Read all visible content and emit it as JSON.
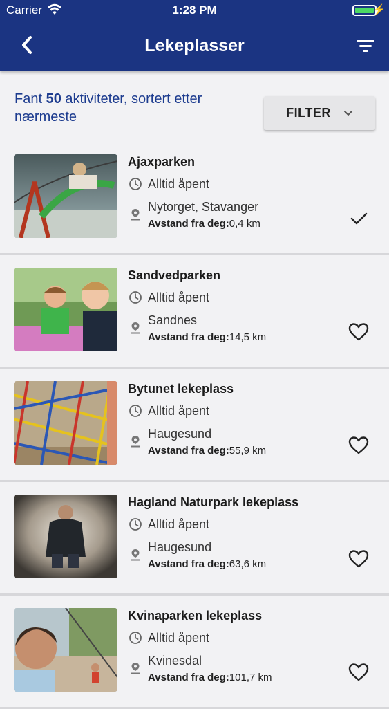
{
  "status": {
    "carrier": "Carrier",
    "time": "1:28 PM"
  },
  "header": {
    "title": "Lekeplasser"
  },
  "summary": {
    "prefix": "Fant ",
    "count": "50",
    "suffix": " aktiviteter, sortert etter nærmeste"
  },
  "filter": {
    "label": "FILTER"
  },
  "distance_label": "Avstand fra deg:",
  "items": [
    {
      "name": "Ajaxparken",
      "hours": "Alltid åpent",
      "place": "Nytorget, Stavanger",
      "distance": "0,4 km",
      "state": "visited"
    },
    {
      "name": "Sandvedparken",
      "hours": "Alltid åpent",
      "place": "Sandnes",
      "distance": "14,5 km",
      "state": "favorite"
    },
    {
      "name": "Bytunet lekeplass",
      "hours": "Alltid åpent",
      "place": "Haugesund",
      "distance": "55,9 km",
      "state": "favorite"
    },
    {
      "name": "Hagland Naturpark lekeplass",
      "hours": "Alltid åpent",
      "place": "Haugesund",
      "distance": "63,6 km",
      "state": "favorite"
    },
    {
      "name": "Kvinaparken lekeplass",
      "hours": "Alltid åpent",
      "place": "Kvinesdal",
      "distance": "101,7 km",
      "state": "favorite"
    }
  ],
  "colors": {
    "header": "#1b3482",
    "accent_text": "#1d3c8f",
    "background": "#f2f2f4"
  }
}
